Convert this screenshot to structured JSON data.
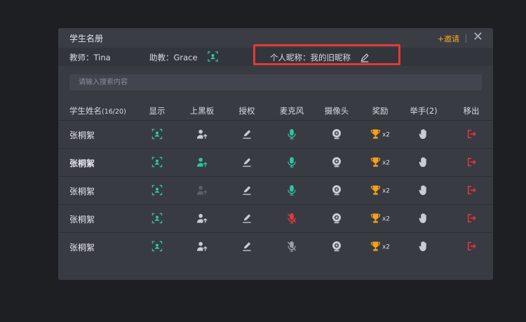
{
  "dialog": {
    "title": "学生名册",
    "invite_label": "+邀请",
    "close_label": "✕"
  },
  "info": {
    "teacher": "教师：Tina",
    "assistant": "助教：Grace",
    "nickname": "个人昵称：我的旧昵称"
  },
  "search": {
    "placeholder": "请输入搜索内容"
  },
  "table": {
    "headers": {
      "name": "学生姓名",
      "count": "(16/20)",
      "show": "显示",
      "board": "上黑板",
      "auth": "授权",
      "mic": "麦克风",
      "camera": "摄像头",
      "reward": "奖励",
      "hand": "举手(2)",
      "remove": "移出"
    },
    "rows": [
      {
        "name": "张桐絮",
        "reward": "x2"
      },
      {
        "name": "张桐絮",
        "reward": "x2"
      },
      {
        "name": "张桐絮",
        "reward": "x2"
      },
      {
        "name": "张桐絮",
        "reward": "x2"
      },
      {
        "name": "张桐絮",
        "reward": "x2"
      }
    ]
  },
  "colors": {
    "accent_green": "#2ec4a0",
    "invite_orange": "#f5a623",
    "trophy_orange": "#f5a21a",
    "danger_red": "#e5393a",
    "icon_gray": "#c9ccd2"
  }
}
